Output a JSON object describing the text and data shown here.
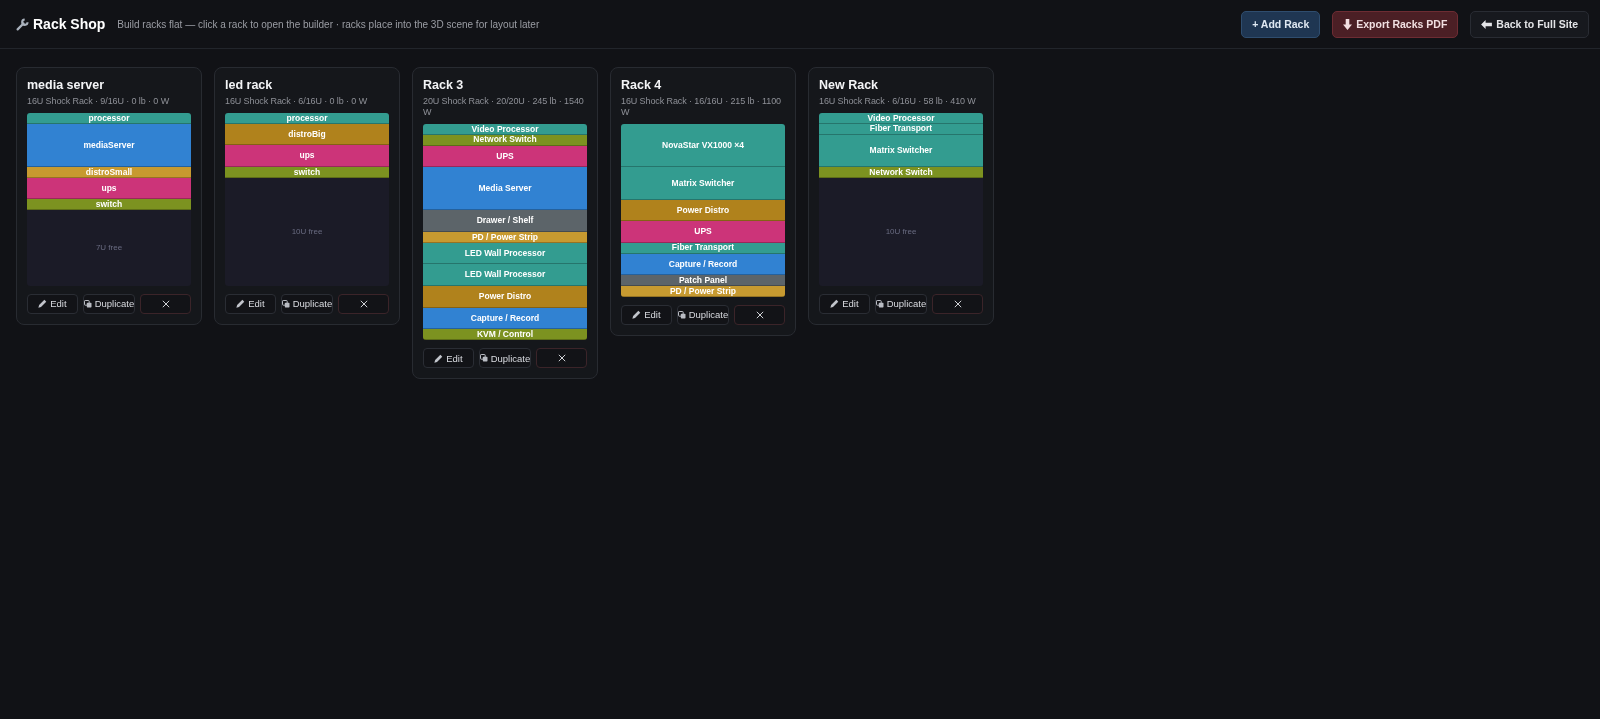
{
  "header": {
    "title": "Rack Shop",
    "subtitle": "Build racks flat — click a rack to open the builder · racks place into the 3D scene for layout later",
    "buttons": [
      {
        "label": "+ Add Rack",
        "kind": "add"
      },
      {
        "label": "Export Racks PDF",
        "kind": "export"
      },
      {
        "label": "Back to Full Site",
        "kind": "back"
      }
    ]
  },
  "racks": [
    {
      "name": "media server",
      "summary": "16U Shock Rack · 9/16U · 0 lb · 0 W",
      "kind": "standard",
      "devices": [
        {
          "label": "processor",
          "kind": "single",
          "color": "#339c90"
        },
        {
          "label": "mediaServer",
          "kind": "quad",
          "color": "#3182d2"
        },
        {
          "label": "distroSmall",
          "kind": "single",
          "color": "#c79a30"
        },
        {
          "label": "ups",
          "kind": "double",
          "color": "#cc3479"
        },
        {
          "label": "switch",
          "kind": "single",
          "color": "#7c9220"
        }
      ],
      "free": "7U free",
      "actions": {
        "edit": "Edit",
        "duplicate": "Duplicate"
      }
    },
    {
      "name": "led rack",
      "summary": "16U Shock Rack · 6/16U · 0 lb · 0 W",
      "kind": "standard",
      "devices": [
        {
          "label": "processor",
          "kind": "single",
          "color": "#339c90"
        },
        {
          "label": "distroBig",
          "kind": "double",
          "color": "#b0821c"
        },
        {
          "label": "ups",
          "kind": "double",
          "color": "#cc3479"
        },
        {
          "label": "switch",
          "kind": "single",
          "color": "#7c9220"
        }
      ],
      "free": "10U free",
      "actions": {
        "edit": "Edit",
        "duplicate": "Duplicate"
      }
    },
    {
      "name": "Rack 3",
      "summary": "20U Shock Rack · 20/20U · 245 lb · 1540 W",
      "kind": "tall",
      "devices": [
        {
          "label": "Video Processor",
          "kind": "single",
          "color": "#339c90"
        },
        {
          "label": "Network Switch",
          "kind": "single",
          "color": "#7c9220"
        },
        {
          "label": "UPS",
          "kind": "double",
          "color": "#cc3479"
        },
        {
          "label": "Media Server",
          "kind": "quad",
          "color": "#3182d2"
        },
        {
          "label": "Drawer / Shelf",
          "kind": "double",
          "color": "#5c6469"
        },
        {
          "label": "PD / Power Strip",
          "kind": "single",
          "color": "#c79a30"
        },
        {
          "label": "LED Wall Processor",
          "kind": "double",
          "color": "#339c90"
        },
        {
          "label": "LED Wall Processor",
          "kind": "double",
          "color": "#339c90"
        },
        {
          "label": "Power Distro",
          "kind": "double",
          "color": "#b0821c"
        },
        {
          "label": "Capture / Record",
          "kind": "double",
          "color": "#3182d2"
        },
        {
          "label": "KVM / Control",
          "kind": "single",
          "color": "#7c9220"
        }
      ],
      "actions": {
        "edit": "Edit",
        "duplicate": "Duplicate"
      }
    },
    {
      "name": "Rack 4",
      "summary": "16U Shock Rack · 16/16U · 215 lb · 1100 W",
      "kind": "standard",
      "devices": [
        {
          "label": "NovaStar VX1000 ×4",
          "kind": "quad",
          "color": "#339c90"
        },
        {
          "label": "Matrix Switcher",
          "kind": "triple",
          "color": "#339c90"
        },
        {
          "label": "Power Distro",
          "kind": "double",
          "color": "#b0821c"
        },
        {
          "label": "UPS",
          "kind": "double",
          "color": "#cc3479"
        },
        {
          "label": "Fiber Transport",
          "kind": "single",
          "color": "#339c90"
        },
        {
          "label": "Capture / Record",
          "kind": "double",
          "color": "#3182d2"
        },
        {
          "label": "Patch Panel",
          "kind": "single",
          "color": "#5c6469"
        },
        {
          "label": "PD / Power Strip",
          "kind": "single",
          "color": "#c79a30"
        }
      ],
      "actions": {
        "edit": "Edit",
        "duplicate": "Duplicate"
      }
    },
    {
      "name": "New Rack",
      "summary": "16U Shock Rack · 6/16U · 58 lb · 410 W",
      "kind": "standard",
      "devices": [
        {
          "label": "Video Processor",
          "kind": "single",
          "color": "#339c90"
        },
        {
          "label": "Fiber Transport",
          "kind": "single",
          "color": "#339c90"
        },
        {
          "label": "Matrix Switcher",
          "kind": "triple",
          "color": "#339c90"
        },
        {
          "label": "Network Switch",
          "kind": "single",
          "color": "#7c9220"
        }
      ],
      "free": "10U free",
      "actions": {
        "edit": "Edit",
        "duplicate": "Duplicate"
      }
    }
  ]
}
